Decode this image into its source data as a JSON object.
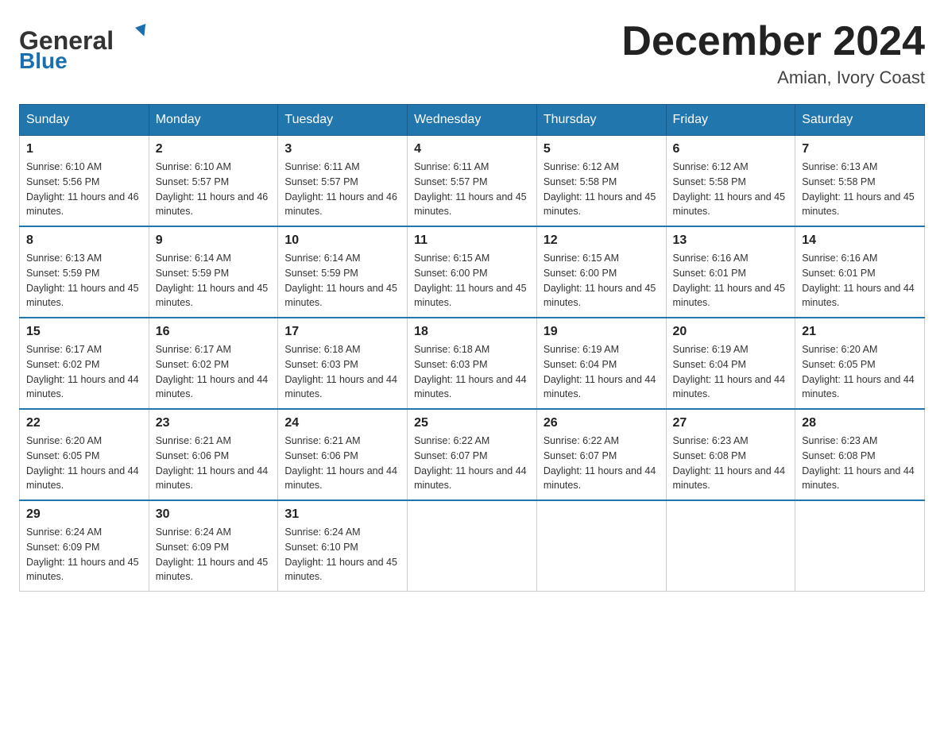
{
  "header": {
    "logo_line1": "General",
    "logo_line2": "Blue",
    "month_title": "December 2024",
    "location": "Amian, Ivory Coast"
  },
  "weekdays": [
    "Sunday",
    "Monday",
    "Tuesday",
    "Wednesday",
    "Thursday",
    "Friday",
    "Saturday"
  ],
  "weeks": [
    [
      {
        "day": "1",
        "sunrise": "6:10 AM",
        "sunset": "5:56 PM",
        "daylight": "11 hours and 46 minutes."
      },
      {
        "day": "2",
        "sunrise": "6:10 AM",
        "sunset": "5:57 PM",
        "daylight": "11 hours and 46 minutes."
      },
      {
        "day": "3",
        "sunrise": "6:11 AM",
        "sunset": "5:57 PM",
        "daylight": "11 hours and 46 minutes."
      },
      {
        "day": "4",
        "sunrise": "6:11 AM",
        "sunset": "5:57 PM",
        "daylight": "11 hours and 45 minutes."
      },
      {
        "day": "5",
        "sunrise": "6:12 AM",
        "sunset": "5:58 PM",
        "daylight": "11 hours and 45 minutes."
      },
      {
        "day": "6",
        "sunrise": "6:12 AM",
        "sunset": "5:58 PM",
        "daylight": "11 hours and 45 minutes."
      },
      {
        "day": "7",
        "sunrise": "6:13 AM",
        "sunset": "5:58 PM",
        "daylight": "11 hours and 45 minutes."
      }
    ],
    [
      {
        "day": "8",
        "sunrise": "6:13 AM",
        "sunset": "5:59 PM",
        "daylight": "11 hours and 45 minutes."
      },
      {
        "day": "9",
        "sunrise": "6:14 AM",
        "sunset": "5:59 PM",
        "daylight": "11 hours and 45 minutes."
      },
      {
        "day": "10",
        "sunrise": "6:14 AM",
        "sunset": "5:59 PM",
        "daylight": "11 hours and 45 minutes."
      },
      {
        "day": "11",
        "sunrise": "6:15 AM",
        "sunset": "6:00 PM",
        "daylight": "11 hours and 45 minutes."
      },
      {
        "day": "12",
        "sunrise": "6:15 AM",
        "sunset": "6:00 PM",
        "daylight": "11 hours and 45 minutes."
      },
      {
        "day": "13",
        "sunrise": "6:16 AM",
        "sunset": "6:01 PM",
        "daylight": "11 hours and 45 minutes."
      },
      {
        "day": "14",
        "sunrise": "6:16 AM",
        "sunset": "6:01 PM",
        "daylight": "11 hours and 44 minutes."
      }
    ],
    [
      {
        "day": "15",
        "sunrise": "6:17 AM",
        "sunset": "6:02 PM",
        "daylight": "11 hours and 44 minutes."
      },
      {
        "day": "16",
        "sunrise": "6:17 AM",
        "sunset": "6:02 PM",
        "daylight": "11 hours and 44 minutes."
      },
      {
        "day": "17",
        "sunrise": "6:18 AM",
        "sunset": "6:03 PM",
        "daylight": "11 hours and 44 minutes."
      },
      {
        "day": "18",
        "sunrise": "6:18 AM",
        "sunset": "6:03 PM",
        "daylight": "11 hours and 44 minutes."
      },
      {
        "day": "19",
        "sunrise": "6:19 AM",
        "sunset": "6:04 PM",
        "daylight": "11 hours and 44 minutes."
      },
      {
        "day": "20",
        "sunrise": "6:19 AM",
        "sunset": "6:04 PM",
        "daylight": "11 hours and 44 minutes."
      },
      {
        "day": "21",
        "sunrise": "6:20 AM",
        "sunset": "6:05 PM",
        "daylight": "11 hours and 44 minutes."
      }
    ],
    [
      {
        "day": "22",
        "sunrise": "6:20 AM",
        "sunset": "6:05 PM",
        "daylight": "11 hours and 44 minutes."
      },
      {
        "day": "23",
        "sunrise": "6:21 AM",
        "sunset": "6:06 PM",
        "daylight": "11 hours and 44 minutes."
      },
      {
        "day": "24",
        "sunrise": "6:21 AM",
        "sunset": "6:06 PM",
        "daylight": "11 hours and 44 minutes."
      },
      {
        "day": "25",
        "sunrise": "6:22 AM",
        "sunset": "6:07 PM",
        "daylight": "11 hours and 44 minutes."
      },
      {
        "day": "26",
        "sunrise": "6:22 AM",
        "sunset": "6:07 PM",
        "daylight": "11 hours and 44 minutes."
      },
      {
        "day": "27",
        "sunrise": "6:23 AM",
        "sunset": "6:08 PM",
        "daylight": "11 hours and 44 minutes."
      },
      {
        "day": "28",
        "sunrise": "6:23 AM",
        "sunset": "6:08 PM",
        "daylight": "11 hours and 44 minutes."
      }
    ],
    [
      {
        "day": "29",
        "sunrise": "6:24 AM",
        "sunset": "6:09 PM",
        "daylight": "11 hours and 45 minutes."
      },
      {
        "day": "30",
        "sunrise": "6:24 AM",
        "sunset": "6:09 PM",
        "daylight": "11 hours and 45 minutes."
      },
      {
        "day": "31",
        "sunrise": "6:24 AM",
        "sunset": "6:10 PM",
        "daylight": "11 hours and 45 minutes."
      },
      null,
      null,
      null,
      null
    ]
  ]
}
